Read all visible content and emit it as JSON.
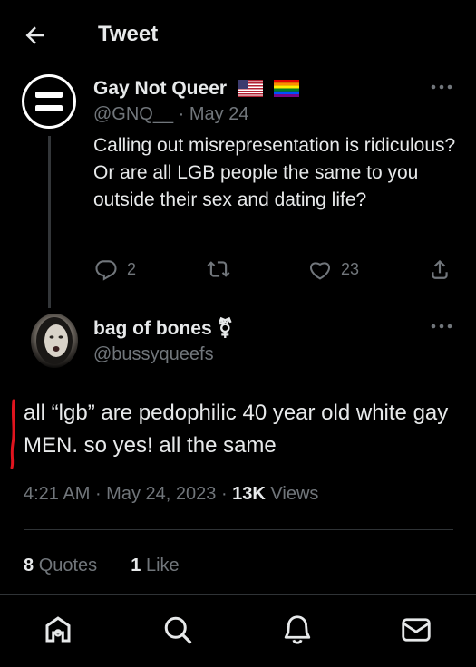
{
  "header": {
    "title": "Tweet"
  },
  "parent_tweet": {
    "display_name": "Gay Not Queer",
    "handle": "@GNQ__",
    "date": "May 24",
    "text": "Calling out misrepresentation is ridiculous? Or are all LGB people the same to you outside their sex and dating life?",
    "replies": "2",
    "retweets": "",
    "likes": "23"
  },
  "main_tweet": {
    "display_name": "bag of bones",
    "name_emoji": "⚧",
    "handle": "@bussyqueefs",
    "text": "all “lgb” are pedophilic 40 year old white gay MEN. so yes! all the same",
    "time": "4:21 AM",
    "date": "May 24, 2023",
    "views_count": "13K",
    "views_label": "Views",
    "quotes_count": "8",
    "quotes_label": "Quotes",
    "likes_count": "1",
    "likes_label": "Like"
  },
  "colors": {
    "background": "#000000",
    "text": "#e7e9ea",
    "muted": "#71767b",
    "annotation_red": "#e0141e"
  },
  "icons": [
    "back-arrow-icon",
    "more-icon",
    "reply-icon",
    "retweet-icon",
    "like-icon",
    "share-icon",
    "home-icon",
    "search-icon",
    "notifications-icon",
    "messages-icon"
  ]
}
